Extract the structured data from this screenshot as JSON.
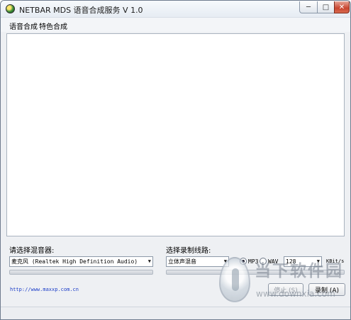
{
  "window": {
    "title": "NETBAR MDS 语音合成服务 V 1.0",
    "minimize_glyph": "─",
    "maximize_glyph": "□",
    "close_glyph": "✕"
  },
  "menu": {
    "items": [
      {
        "label": "语音合成"
      },
      {
        "label": "特色合成"
      }
    ]
  },
  "mixer": {
    "label": "请选择混音器:",
    "selected": "麦克风 (Realtek High Definition Audio)"
  },
  "line": {
    "label": "选择录制线路:",
    "selected": "立体声混音"
  },
  "format": {
    "options": [
      {
        "label": "MP3",
        "checked": true
      },
      {
        "label": "WAV",
        "checked": false
      }
    ]
  },
  "bitrate": {
    "selected": "128",
    "unit": "KBit/s"
  },
  "link": {
    "text": "http://www.maxxp.com.cn"
  },
  "buttons": {
    "stop": "停止 (S)",
    "record": "录制 (A)"
  },
  "watermark": {
    "title": "当下软件园",
    "url": "www.downxia.com"
  },
  "colors": {
    "link": "#1a3cc8",
    "close_button": "#c9452f"
  }
}
